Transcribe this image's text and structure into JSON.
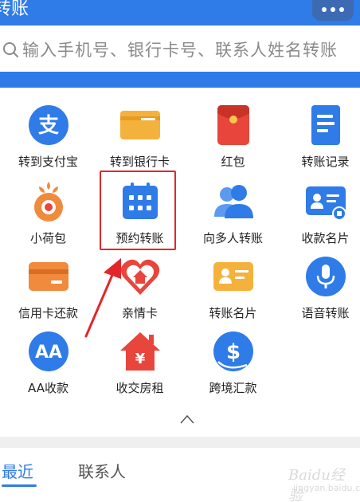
{
  "header": {
    "title": "转账",
    "more_icon": "more-dots-icon"
  },
  "search": {
    "placeholder": "输入手机号、银行卡号、联系人姓名转账",
    "icon": "search-icon"
  },
  "grid": {
    "items": [
      {
        "label": "转到支付宝",
        "icon": "alipay-icon",
        "color": "#2f7be8"
      },
      {
        "label": "转到银行卡",
        "icon": "bank-card-icon",
        "color": "#f4a830"
      },
      {
        "label": "红包",
        "icon": "red-envelope-icon",
        "color": "#e8453c"
      },
      {
        "label": "转账记录",
        "icon": "transfer-record-icon",
        "color": "#2f7be8"
      },
      {
        "label": "小荷包",
        "icon": "small-wallet-icon",
        "color": "#f08a3c"
      },
      {
        "label": "预约转账",
        "icon": "calendar-icon",
        "color": "#2f7be8"
      },
      {
        "label": "向多人转账",
        "icon": "multi-person-icon",
        "color": "#2f7be8"
      },
      {
        "label": "收款名片",
        "icon": "receive-card-icon",
        "color": "#2f7be8"
      },
      {
        "label": "信用卡还款",
        "icon": "credit-card-icon",
        "color": "#f08a3c"
      },
      {
        "label": "亲情卡",
        "icon": "family-card-icon",
        "color": "#e8453c"
      },
      {
        "label": "转账名片",
        "icon": "transfer-card-icon",
        "color": "#f4a830"
      },
      {
        "label": "语音转账",
        "icon": "microphone-icon",
        "color": "#2f7be8"
      },
      {
        "label": "AA收款",
        "icon": "aa-icon",
        "color": "#2f7be8"
      },
      {
        "label": "收交房租",
        "icon": "rent-house-icon",
        "color": "#e8453c"
      },
      {
        "label": "跨境汇款",
        "icon": "cross-border-icon",
        "color": "#2f7be8"
      }
    ]
  },
  "collapse_icon": "chevron-up-icon",
  "tabs": {
    "recent": "最近",
    "contacts": "联系人"
  },
  "watermark": {
    "text": "Baidu经验",
    "sub": "jingyan.baidu.com"
  },
  "colors": {
    "primary": "#2f7be8",
    "highlight": "#e3262a"
  }
}
